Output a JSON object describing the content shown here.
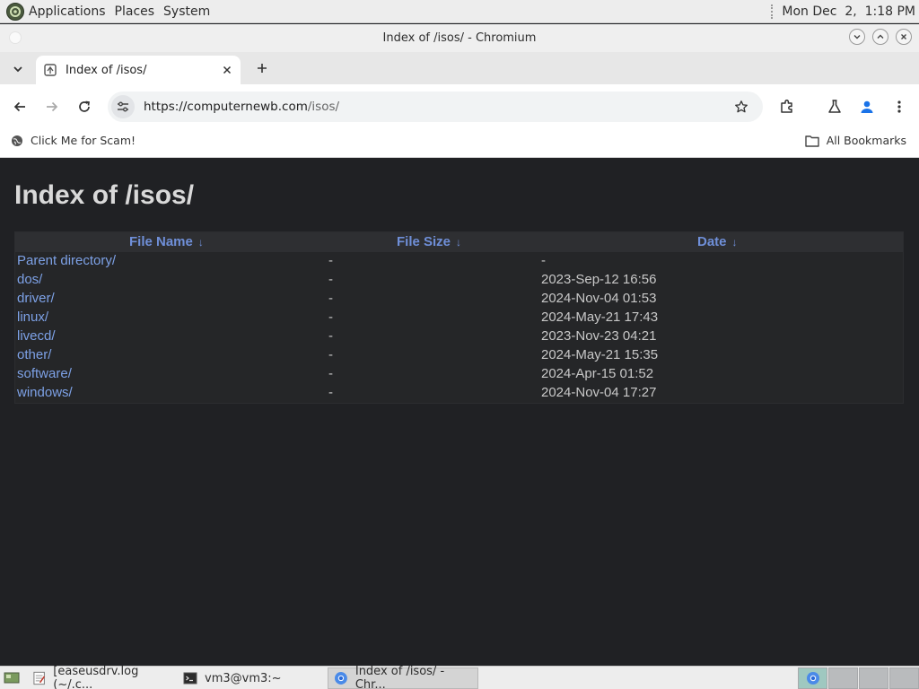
{
  "top_panel": {
    "menus": [
      "Applications",
      "Places",
      "System"
    ],
    "clock": "Mon Dec  2,  1:18 PM"
  },
  "window": {
    "title": "Index of /isos/ - Chromium"
  },
  "tabs": [
    {
      "title": "Index of /isos/"
    }
  ],
  "omnibox": {
    "url_host": "https://computernewb.com",
    "url_path": "/isos/"
  },
  "bookmarks": {
    "items": [
      "Click Me for Scam!"
    ],
    "all_label": "All Bookmarks"
  },
  "page": {
    "heading": "Index of /isos/",
    "columns": [
      {
        "label": "File Name",
        "sort_icon": "arrow-down-icon"
      },
      {
        "label": "File Size",
        "sort_icon": "arrow-down-icon"
      },
      {
        "label": "Date",
        "sort_icon": "arrow-down-icon"
      }
    ],
    "rows": [
      {
        "name": "Parent directory/",
        "size": "-",
        "date": "-"
      },
      {
        "name": "dos/",
        "size": "-",
        "date": "2023-Sep-12 16:56"
      },
      {
        "name": "driver/",
        "size": "-",
        "date": "2024-Nov-04 01:53"
      },
      {
        "name": "linux/",
        "size": "-",
        "date": "2024-May-21 17:43"
      },
      {
        "name": "livecd/",
        "size": "-",
        "date": "2023-Nov-23 04:21"
      },
      {
        "name": "other/",
        "size": "-",
        "date": "2024-May-21 15:35"
      },
      {
        "name": "software/",
        "size": "-",
        "date": "2024-Apr-15 01:52"
      },
      {
        "name": "windows/",
        "size": "-",
        "date": "2024-Nov-04 17:27"
      }
    ]
  },
  "taskbar": {
    "tasks": [
      {
        "label": "[easeusdrv.log (~/.c...",
        "icon": "text-editor-icon"
      },
      {
        "label": "vm3@vm3:~",
        "icon": "terminal-icon"
      },
      {
        "label": "Index of /isos/ - Chr...",
        "icon": "chromium-icon"
      }
    ]
  },
  "colors": {
    "page_background": "#202124",
    "link": "#7da1e6",
    "header_text": "#6f8fd8",
    "heading": "#d9d9d9"
  }
}
